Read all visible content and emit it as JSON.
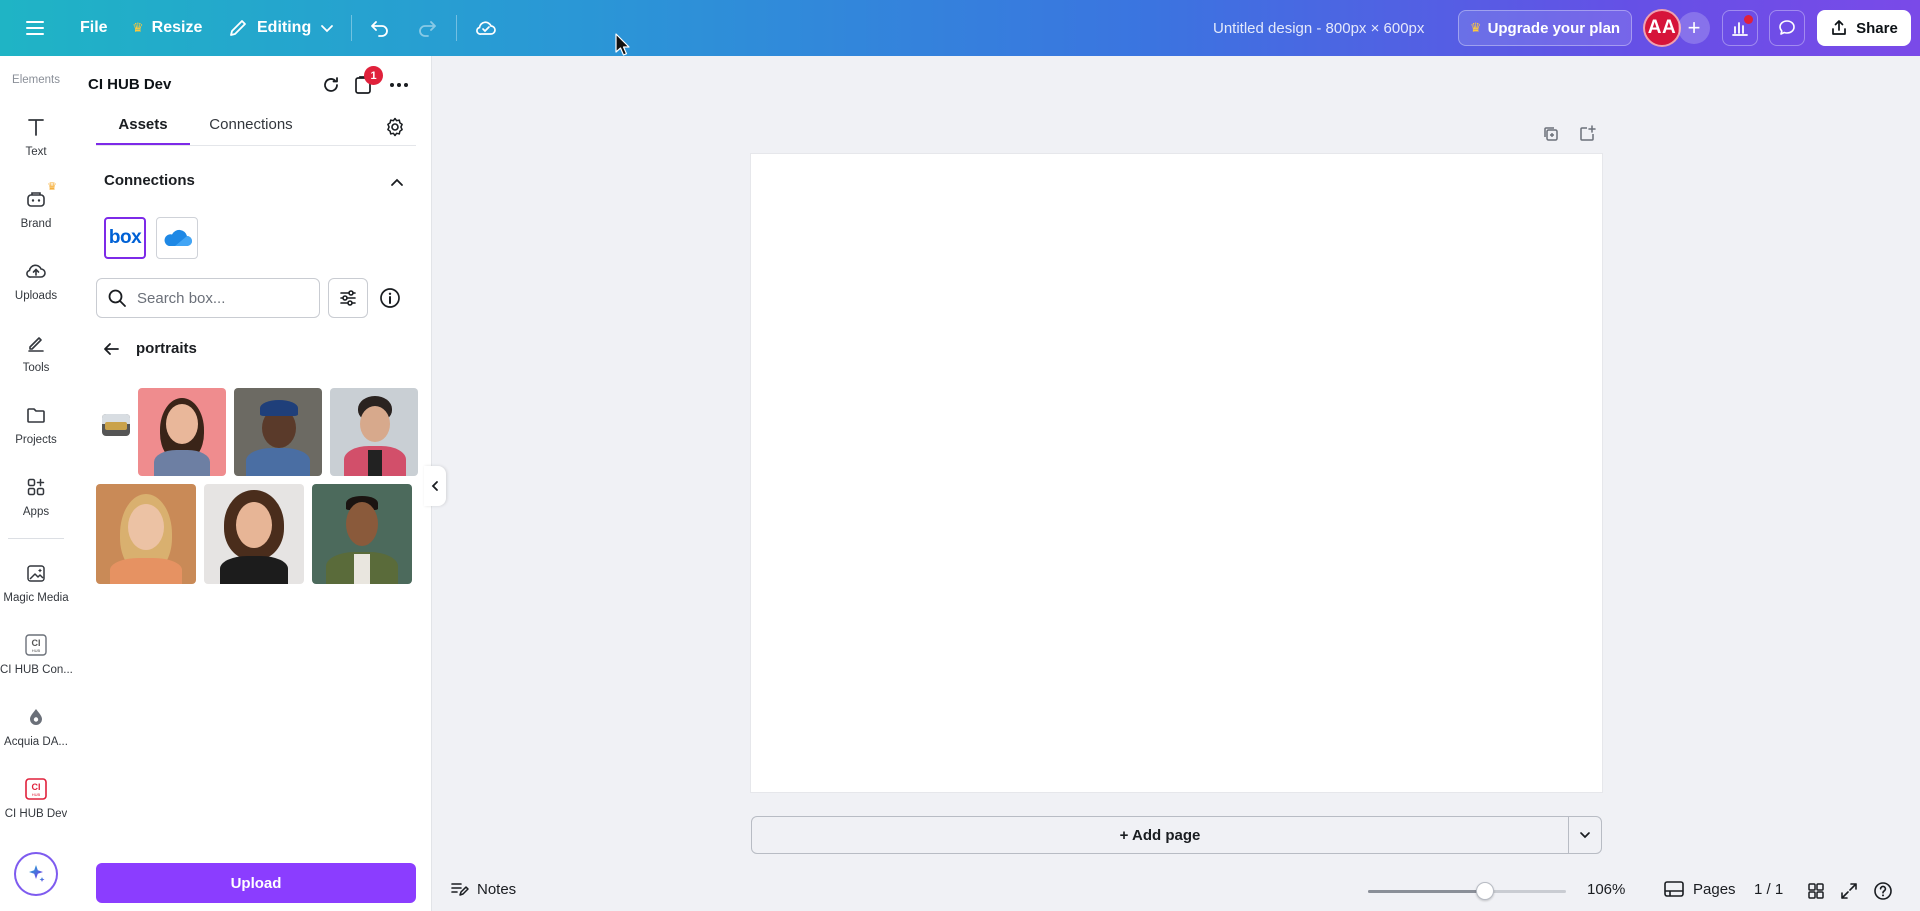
{
  "topbar": {
    "file_label": "File",
    "resize_label": "Resize",
    "editing_label": "Editing",
    "doc_title": "Untitled design - 800px × 600px",
    "upgrade_label": "Upgrade your plan",
    "avatar_initials": "AA",
    "share_label": "Share"
  },
  "rail": {
    "top_label": "Elements",
    "items": [
      {
        "label": "Text",
        "icon": "text-icon"
      },
      {
        "label": "Brand",
        "icon": "brand-icon"
      },
      {
        "label": "Uploads",
        "icon": "upload-cloud-icon"
      },
      {
        "label": "Tools",
        "icon": "pen-icon"
      },
      {
        "label": "Projects",
        "icon": "folder-icon"
      },
      {
        "label": "Apps",
        "icon": "apps-grid-icon"
      },
      {
        "label": "Magic Media",
        "icon": "magic-media-icon"
      },
      {
        "label": "CI HUB Con...",
        "icon": "ci-hub-icon"
      },
      {
        "label": "Acquia DA...",
        "icon": "acquia-icon"
      },
      {
        "label": "CI HUB Dev",
        "icon": "ci-hub-red-icon"
      }
    ]
  },
  "panel": {
    "title": "CI HUB Dev",
    "badge_count": "1",
    "tabs": [
      "Assets",
      "Connections"
    ],
    "section_title": "Connections",
    "box_logo_text": "box",
    "search_placeholder": "Search box...",
    "folder_name": "portraits",
    "upload_label": "Upload"
  },
  "canvas": {
    "add_page_label": "+ Add page"
  },
  "bottombar": {
    "notes_label": "Notes",
    "zoom_value": "106%",
    "zoom_level": 0.59,
    "pages_label": "Pages",
    "page_count": "1 / 1"
  },
  "colors": {
    "accent": "#8b3dff",
    "tab_underline": "#7d2ae8",
    "badge": "#e0213b",
    "avatar": "#d6143a",
    "topbar_gradient_start": "#1fb4c5",
    "topbar_gradient_end": "#7a4ae8"
  }
}
